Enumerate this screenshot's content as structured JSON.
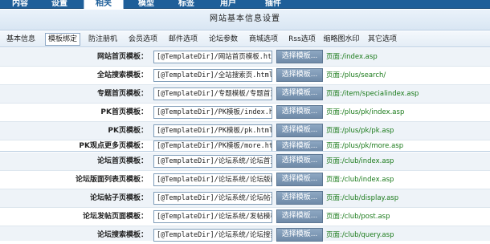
{
  "topnav": {
    "tabs": [
      "内容",
      "设置",
      "相关",
      "模型",
      "标签",
      "用户",
      "插件"
    ],
    "active_index": 2
  },
  "page_title": "网站基本信息设置",
  "subtabs": {
    "items": [
      "基本信息",
      "模板绑定",
      "防注册机",
      "会员选项",
      "邮件选项",
      "论坛参数",
      "商城选项",
      "Rss选项",
      "缩略图水印",
      "其它选项"
    ],
    "active_index": 1
  },
  "select_button_label": "选择模板...",
  "rows": [
    {
      "label": "网站首页模板：",
      "value": "[@TemplateDir]/网站首页模板.html",
      "path": "页面:/index.asp"
    },
    {
      "label": "全站搜索模板：",
      "value": "[@TemplateDir]/全站搜索页.html",
      "path": "页面:/plus/search/"
    },
    {
      "label": "专题首页模板：",
      "value": "[@TemplateDir]/专题模板/专题首页模",
      "path": "页面:/item/specialindex.asp"
    },
    {
      "label": "PK首页模板：",
      "value": "[@TemplateDir]/PK模板/index.html",
      "path": "页面:/plus/pk/index.asp"
    },
    {
      "label": "PK页模板：",
      "value": "[@TemplateDir]/PK模板/pk.html",
      "path": "页面:/plus/pk/pk.asp"
    },
    {
      "label": "PK观点更多页模板：",
      "value": "[@TemplateDir]/PK模板/more.html",
      "path": "页面:/plus/pk/more.asp"
    },
    {
      "label": "论坛首页模板：",
      "value": "[@TemplateDir]/论坛系统/论坛首页模",
      "path": "页面:/club/index.asp"
    },
    {
      "label": "论坛版面列表页模板：",
      "value": "[@TemplateDir]/论坛系统/论坛版面列",
      "path": "页面:/club/index.asp"
    },
    {
      "label": "论坛帖子页模板：",
      "value": "[@TemplateDir]/论坛系统/论坛帖子页",
      "path": "页面:/club/display.asp"
    },
    {
      "label": "论坛发帖页面模板：",
      "value": "[@TemplateDir]/论坛系统/发帖模板.h",
      "path": "页面:/club/post.asp"
    },
    {
      "label": "论坛搜索模板：",
      "value": "[@TemplateDir]/论坛系统/论坛搜索模",
      "path": "页面:/club/query.asp"
    }
  ]
}
